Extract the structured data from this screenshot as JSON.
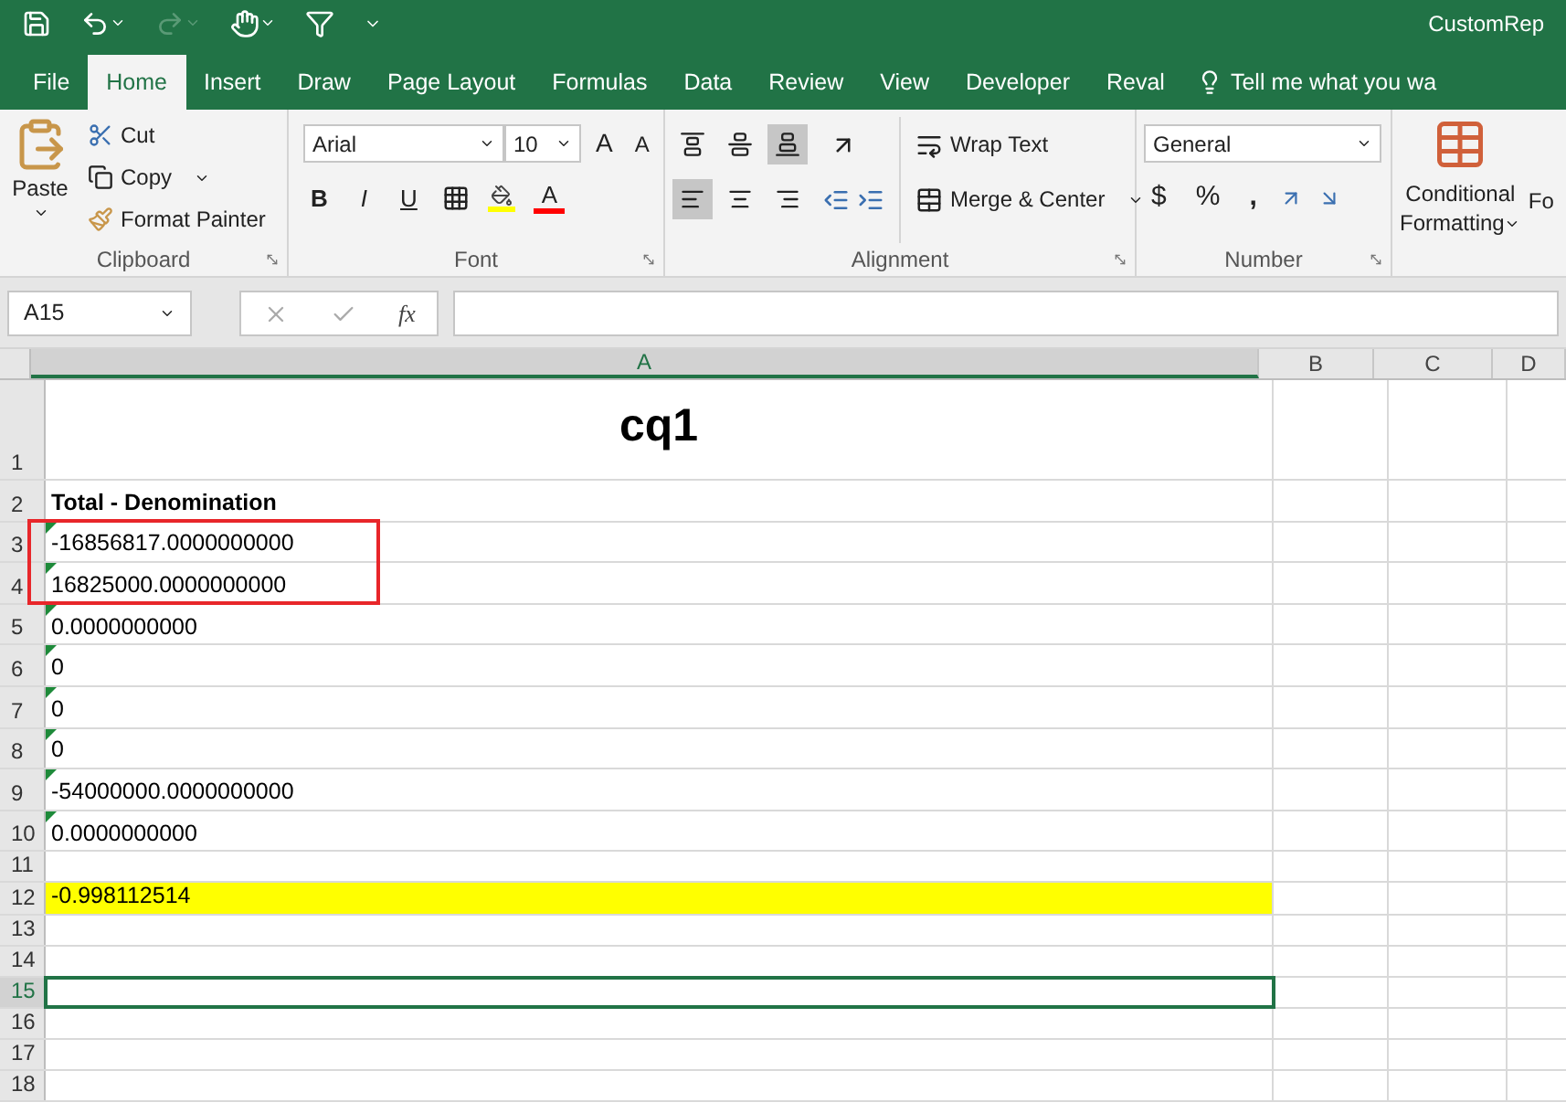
{
  "window": {
    "title": "CustomRep"
  },
  "tabs": [
    {
      "label": "File",
      "selected": false
    },
    {
      "label": "Home",
      "selected": true
    },
    {
      "label": "Insert",
      "selected": false
    },
    {
      "label": "Draw",
      "selected": false
    },
    {
      "label": "Page Layout",
      "selected": false
    },
    {
      "label": "Formulas",
      "selected": false
    },
    {
      "label": "Data",
      "selected": false
    },
    {
      "label": "Review",
      "selected": false
    },
    {
      "label": "View",
      "selected": false
    },
    {
      "label": "Developer",
      "selected": false
    },
    {
      "label": "Reval",
      "selected": false
    }
  ],
  "tell_me": {
    "placeholder": "Tell me what you wa"
  },
  "ribbon": {
    "clipboard": {
      "label": "Clipboard",
      "paste": "Paste",
      "cut": "Cut",
      "copy": "Copy",
      "format_painter": "Format Painter"
    },
    "font": {
      "label": "Font",
      "font_name": "Arial",
      "font_size": "10",
      "grow": "A",
      "shrink": "A",
      "bold": "B",
      "italic": "I",
      "underline": "U",
      "font_color": "A"
    },
    "alignment": {
      "label": "Alignment",
      "wrap_text": "Wrap Text",
      "merge_center": "Merge & Center",
      "vertical": [
        {
          "kind": "top",
          "selected": false
        },
        {
          "kind": "middle",
          "selected": false
        },
        {
          "kind": "bottom",
          "selected": true
        }
      ],
      "horizontal": [
        {
          "kind": "left",
          "selected": true
        },
        {
          "kind": "center",
          "selected": false
        },
        {
          "kind": "right",
          "selected": false
        }
      ]
    },
    "number": {
      "label": "Number",
      "format": "General",
      "currency": "$",
      "percent": "%",
      "comma": ","
    },
    "styles": {
      "conditional_formatting": [
        "Conditional",
        "Formatting"
      ],
      "format_as_table": "Fo"
    }
  },
  "formula_bar": {
    "name_box": "A15",
    "function_label": "fx"
  },
  "columns": [
    {
      "label": "A",
      "selected": true
    },
    {
      "label": "B",
      "selected": false
    },
    {
      "label": "C",
      "selected": false
    },
    {
      "label": "D",
      "selected": false
    }
  ],
  "rows": [
    {
      "number": "1",
      "kind": "title",
      "text": "cq1",
      "error_flag": false,
      "outlined": false,
      "selected": false
    },
    {
      "number": "2",
      "kind": "header",
      "text": "Total - Denomination",
      "error_flag": false,
      "outlined": false,
      "selected": false
    },
    {
      "number": "3",
      "kind": "value",
      "text": "-16856817.0000000000",
      "error_flag": true,
      "outlined": true,
      "selected": false
    },
    {
      "number": "4",
      "kind": "value",
      "text": "16825000.0000000000",
      "error_flag": true,
      "outlined": true,
      "selected": false
    },
    {
      "number": "5",
      "kind": "value",
      "text": "0.0000000000",
      "error_flag": true,
      "outlined": false,
      "selected": false
    },
    {
      "number": "6",
      "kind": "value",
      "text": "0",
      "error_flag": true,
      "outlined": false,
      "selected": false
    },
    {
      "number": "7",
      "kind": "value",
      "text": "0",
      "error_flag": true,
      "outlined": false,
      "selected": false
    },
    {
      "number": "8",
      "kind": "value",
      "text": "0",
      "error_flag": true,
      "outlined": false,
      "selected": false
    },
    {
      "number": "9",
      "kind": "value",
      "text": "-54000000.0000000000",
      "error_flag": true,
      "outlined": false,
      "selected": false
    },
    {
      "number": "10",
      "kind": "value",
      "text": "0.0000000000",
      "error_flag": true,
      "outlined": false,
      "selected": false
    },
    {
      "number": "11",
      "kind": "empty",
      "error_flag": false,
      "outlined": false,
      "selected": false
    },
    {
      "number": "12",
      "kind": "value",
      "text": "-0.998112514",
      "color": "#ffff00",
      "error_flag": false,
      "outlined": false,
      "selected": false
    },
    {
      "number": "13",
      "kind": "empty",
      "error_flag": false,
      "outlined": false,
      "selected": false
    },
    {
      "number": "14",
      "kind": "empty",
      "error_flag": false,
      "outlined": false,
      "selected": false
    },
    {
      "number": "15",
      "kind": "empty",
      "error_flag": false,
      "outlined": false,
      "selected": true
    },
    {
      "number": "16",
      "kind": "empty",
      "error_flag": false,
      "outlined": false,
      "selected": false
    },
    {
      "number": "17",
      "kind": "empty",
      "error_flag": false,
      "outlined": false,
      "selected": false
    },
    {
      "number": "18",
      "kind": "empty",
      "error_flag": false,
      "outlined": false,
      "selected": false
    }
  ]
}
